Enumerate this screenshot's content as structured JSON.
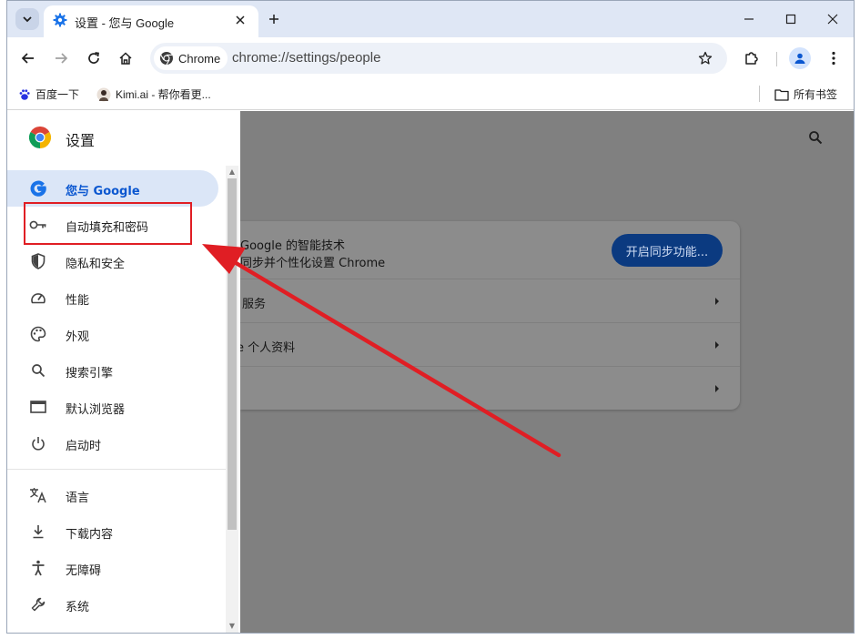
{
  "tab": {
    "title": "设置 - 您与 Google"
  },
  "toolbar": {
    "chip_label": "Chrome",
    "url": "chrome://settings/people"
  },
  "bookmarks": {
    "items": [
      {
        "label": "百度一下",
        "icon": "baidu-paw-icon"
      },
      {
        "label": "Kimi.ai - 帮你看更...",
        "icon": "kimi-avatar-icon"
      }
    ],
    "all_bookmarks": "所有书签"
  },
  "sidebar": {
    "title": "设置",
    "items": [
      {
        "label": "您与 Google",
        "icon": "google-g-icon",
        "active": true
      },
      {
        "label": "自动填充和密码",
        "icon": "key-icon"
      },
      {
        "label": "隐私和安全",
        "icon": "shield-icon"
      },
      {
        "label": "性能",
        "icon": "gauge-icon"
      },
      {
        "label": "外观",
        "icon": "palette-icon"
      },
      {
        "label": "搜索引擎",
        "icon": "search-icon"
      },
      {
        "label": "默认浏览器",
        "icon": "browser-window-icon"
      },
      {
        "label": "启动时",
        "icon": "power-icon"
      },
      {
        "label": "语言",
        "icon": "translate-icon"
      },
      {
        "label": "下载内容",
        "icon": "download-icon"
      },
      {
        "label": "无障碍",
        "icon": "accessibility-icon"
      },
      {
        "label": "系统",
        "icon": "wrench-icon"
      }
    ]
  },
  "main": {
    "sync_line1": "Google 的智能技术",
    "sync_line2": "同步并个性化设置 Chrome",
    "sync_button": "开启同步功能...",
    "rows": [
      {
        "label": "服务"
      },
      {
        "label": "e 个人资料"
      },
      {
        "label": ""
      }
    ]
  },
  "colors": {
    "accent": "#0b57d0",
    "annotation": "#e01e24",
    "overlay": "#808080"
  }
}
